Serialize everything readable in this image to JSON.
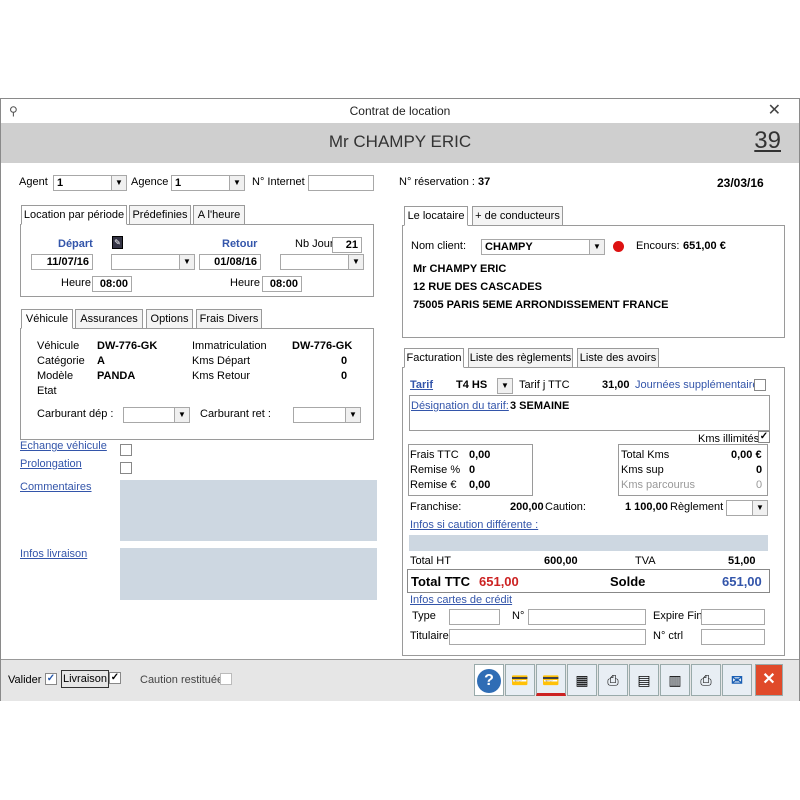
{
  "window": {
    "title": "Contrat de location",
    "client_header": "Mr CHAMPY  ERIC",
    "contract_number": "39"
  },
  "top": {
    "agent_label": "Agent",
    "agent_value": "1",
    "agence_label": "Agence",
    "agence_value": "1",
    "internet_label": "N° Internet",
    "internet_value": "",
    "reservation_label": "N° réservation :",
    "reservation_value": "37",
    "date": "23/03/16"
  },
  "period_tabs": [
    "Location par période",
    "Prédefinies",
    "A l'heure"
  ],
  "period": {
    "depart_label": "Départ",
    "depart_date": "11/07/16",
    "retour_label": "Retour",
    "retour_date": "01/08/16",
    "nb_jour_label": "Nb Jour",
    "nb_jour_value": "21",
    "heure_label": "Heure",
    "heure_depart": "08:00",
    "heure_retour": "08:00"
  },
  "vehicle_tabs": [
    "Véhicule",
    "Assurances",
    "Options",
    "Frais Divers"
  ],
  "vehicle": {
    "vehicule_label": "Véhicule",
    "vehicule_value": "DW-776-GK",
    "categorie_label": "Catégorie",
    "categorie_value": "A",
    "modele_label": "Modèle",
    "modele_value": "PANDA",
    "etat_label": "Etat",
    "immat_label": "Immatriculation",
    "immat_value": "DW-776-GK",
    "kms_depart_label": "Kms Départ",
    "kms_depart_value": "0",
    "kms_retour_label": "Kms Retour",
    "kms_retour_value": "0",
    "carb_dep_label": "Carburant dép :",
    "carb_ret_label": "Carburant ret :"
  },
  "left_links": {
    "echange": "Echange véhicule",
    "prolongation": "Prolongation",
    "commentaires": "Commentaires",
    "livraison": "Infos livraison"
  },
  "client_tabs": [
    "Le locataire",
    "+ de conducteurs"
  ],
  "client": {
    "nom_label": "Nom client:",
    "nom_value": "CHAMPY",
    "encours_label": "Encours:",
    "encours_value": "651,00 €",
    "line1": "Mr CHAMPY ERIC",
    "line2": "12 RUE DES CASCADES",
    "line3": "75005 PARIS 5EME ARRONDISSEMENT FRANCE"
  },
  "billing_tabs": [
    "Facturation",
    "Liste des règlements",
    "Liste des avoirs"
  ],
  "billing": {
    "tarif_label": "Tarif",
    "tarif_value": "T4 HS",
    "tarif_ttc_label": "Tarif j TTC",
    "tarif_ttc_value": "31,00",
    "jours_supp_label": "Journées supplémentaires",
    "designation_label": "Désignation du tarif:",
    "designation_value": "3 SEMAINE",
    "kms_illimites_label": "Kms illimités",
    "frais_label": "Frais TTC",
    "frais_value": "0,00",
    "remise_pct_label": "Remise %",
    "remise_pct_value": "0",
    "remise_eur_label": "Remise €",
    "remise_eur_value": "0,00",
    "total_kms_label": "Total Kms",
    "total_kms_value": "0,00 €",
    "kms_sup_label": "Kms sup",
    "kms_sup_value": "0",
    "kms_parcourus_label": "Kms parcourus",
    "kms_parcourus_value": "0",
    "franchise_label": "Franchise:",
    "franchise_value": "200,00",
    "caution_label": "Caution:",
    "caution_value": "1 100,00",
    "reglement_label": "Règlement",
    "infos_caution_label": "Infos si caution différente :",
    "total_ht_label": "Total HT",
    "total_ht_value": "600,00",
    "tva_label": "TVA",
    "tva_value": "51,00",
    "total_ttc_label": "Total TTC",
    "total_ttc_value": "651,00",
    "solde_label": "Solde",
    "solde_value": "651,00",
    "cartes_label": "Infos cartes de crédit",
    "type_label": "Type",
    "n_label": "N°",
    "expire_label": "Expire Fin",
    "titulaire_label": "Titulaire",
    "nctrl_label": "N° ctrl"
  },
  "footer": {
    "valider_label": "Valider",
    "livraison_label": "Livraison",
    "caution_label": "Caution restituée"
  },
  "colors": {
    "header_bg": "#cfcfcf",
    "link": "#3355aa",
    "total_red": "#cc2222",
    "solde_blue": "#3355aa",
    "close_red": "#e04a2a"
  }
}
